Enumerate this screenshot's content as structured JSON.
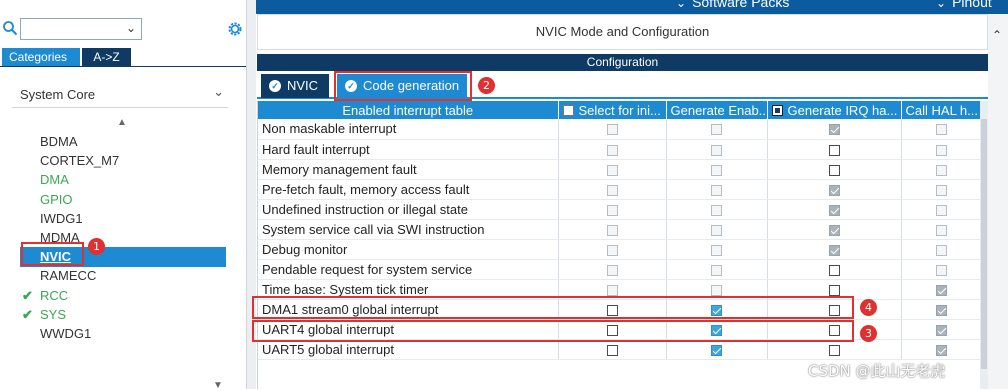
{
  "topbar": {
    "software_packs": "Software Packs",
    "pinout": "Pinout"
  },
  "left_panel": {
    "search_placeholder": "",
    "tabs": [
      "Categories",
      "A->Z"
    ],
    "category": "System Core",
    "peripherals": [
      {
        "name": "BDMA",
        "status": "none"
      },
      {
        "name": "CORTEX_M7",
        "status": "none"
      },
      {
        "name": "DMA",
        "status": "green"
      },
      {
        "name": "GPIO",
        "status": "green"
      },
      {
        "name": "IWDG1",
        "status": "none"
      },
      {
        "name": "MDMA",
        "status": "none"
      },
      {
        "name": "NVIC",
        "status": "selected"
      },
      {
        "name": "RAMECC",
        "status": "none"
      },
      {
        "name": "RCC",
        "status": "checked"
      },
      {
        "name": "SYS",
        "status": "checked"
      },
      {
        "name": "WWDG1",
        "status": "none"
      }
    ]
  },
  "main": {
    "title": "NVIC Mode and Configuration",
    "config_label": "Configuration",
    "subtabs": [
      "NVIC",
      "Code generation"
    ],
    "table": {
      "headers": [
        "Enabled interrupt table",
        "Select for ini...",
        "Generate Enab...",
        "Generate IRQ ha...",
        "Call HAL h..."
      ],
      "header_checkbox": [
        false,
        true,
        true,
        false
      ],
      "rows": [
        {
          "name": "Non maskable interrupt",
          "c1": "d0",
          "c2": "d0",
          "c3": "d1",
          "c4": "d0"
        },
        {
          "name": "Hard fault interrupt",
          "c1": "d0",
          "c2": "d0",
          "c3": "e0",
          "c4": "d0"
        },
        {
          "name": "Memory management fault",
          "c1": "d0",
          "c2": "d0",
          "c3": "e0",
          "c4": "d0"
        },
        {
          "name": "Pre-fetch fault, memory access fault",
          "c1": "d0",
          "c2": "d0",
          "c3": "d1",
          "c4": "d0"
        },
        {
          "name": "Undefined instruction or illegal state",
          "c1": "d0",
          "c2": "d0",
          "c3": "d1",
          "c4": "d0"
        },
        {
          "name": "System service call via SWI instruction",
          "c1": "d0",
          "c2": "d0",
          "c3": "d1",
          "c4": "d0"
        },
        {
          "name": "Debug monitor",
          "c1": "d0",
          "c2": "d0",
          "c3": "d1",
          "c4": "d0"
        },
        {
          "name": "Pendable request for system service",
          "c1": "d0",
          "c2": "d0",
          "c3": "e0",
          "c4": "d0"
        },
        {
          "name": "Time base: System tick timer",
          "c1": "d0",
          "c2": "d0",
          "c3": "e0",
          "c4": "x1"
        },
        {
          "name": "DMA1 stream0 global interrupt",
          "c1": "e0",
          "c2": "e1",
          "c3": "e0",
          "c4": "x1"
        },
        {
          "name": "UART4 global interrupt",
          "c1": "e0",
          "c2": "e1",
          "c3": "e0",
          "c4": "x1"
        },
        {
          "name": "UART5 global interrupt",
          "c1": "e0",
          "c2": "e1",
          "c3": "e0",
          "c4": "x1"
        }
      ]
    }
  },
  "annotations": [
    "1",
    "2",
    "3",
    "4"
  ],
  "watermark": "CSDN @此山无老虎",
  "colors": {
    "accent": "#1d8ad1",
    "dark": "#0f3a63",
    "ok_green": "#3aa853",
    "annotation_red": "#e03030"
  }
}
